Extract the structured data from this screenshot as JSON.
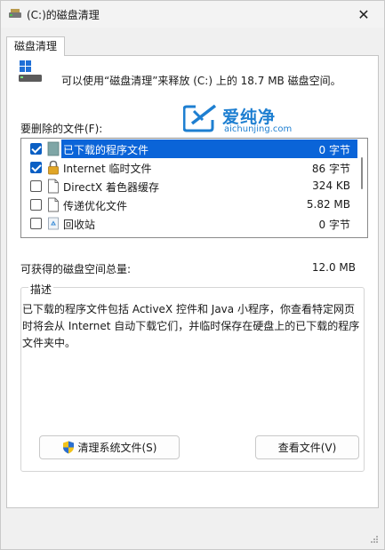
{
  "window": {
    "title": "(C:)的磁盘清理",
    "close_glyph": "✕"
  },
  "tabs": [
    {
      "label": "磁盘清理"
    }
  ],
  "intro_text": "可以使用“磁盘清理”来释放 (C:) 上的 18.7 MB 磁盘空间。",
  "watermark": {
    "cn": "爱纯净",
    "en": "aichunjing.com"
  },
  "files_label": "要删除的文件(F):",
  "files": [
    {
      "name": "已下载的程序文件",
      "size": "0 字节",
      "checked": true,
      "selected": true,
      "icon": "folder-icon"
    },
    {
      "name": "Internet 临时文件",
      "size": "86 字节",
      "checked": true,
      "selected": false,
      "icon": "lock-icon"
    },
    {
      "name": "DirectX 着色器缓存",
      "size": "324 KB",
      "checked": false,
      "selected": false,
      "icon": "file-icon"
    },
    {
      "name": "传递优化文件",
      "size": "5.82 MB",
      "checked": false,
      "selected": false,
      "icon": "file-icon"
    },
    {
      "name": "回收站",
      "size": "0 字节",
      "checked": false,
      "selected": false,
      "icon": "recycle-bin-icon"
    }
  ],
  "total": {
    "label": "可获得的磁盘空间总量:",
    "value": "12.0 MB"
  },
  "description": {
    "legend": "描述",
    "text": "已下载的程序文件包括 ActiveX 控件和 Java 小程序，你查看特定网页时将会从 Internet 自动下载它们，并临时保存在硬盘上的已下载的程序文件夹中。"
  },
  "buttons": {
    "clean_system": "清理系统文件(S)",
    "view_files": "查看文件(V)"
  },
  "colors": {
    "selection": "#0a64d8",
    "watermark": "#1e7fd1"
  }
}
